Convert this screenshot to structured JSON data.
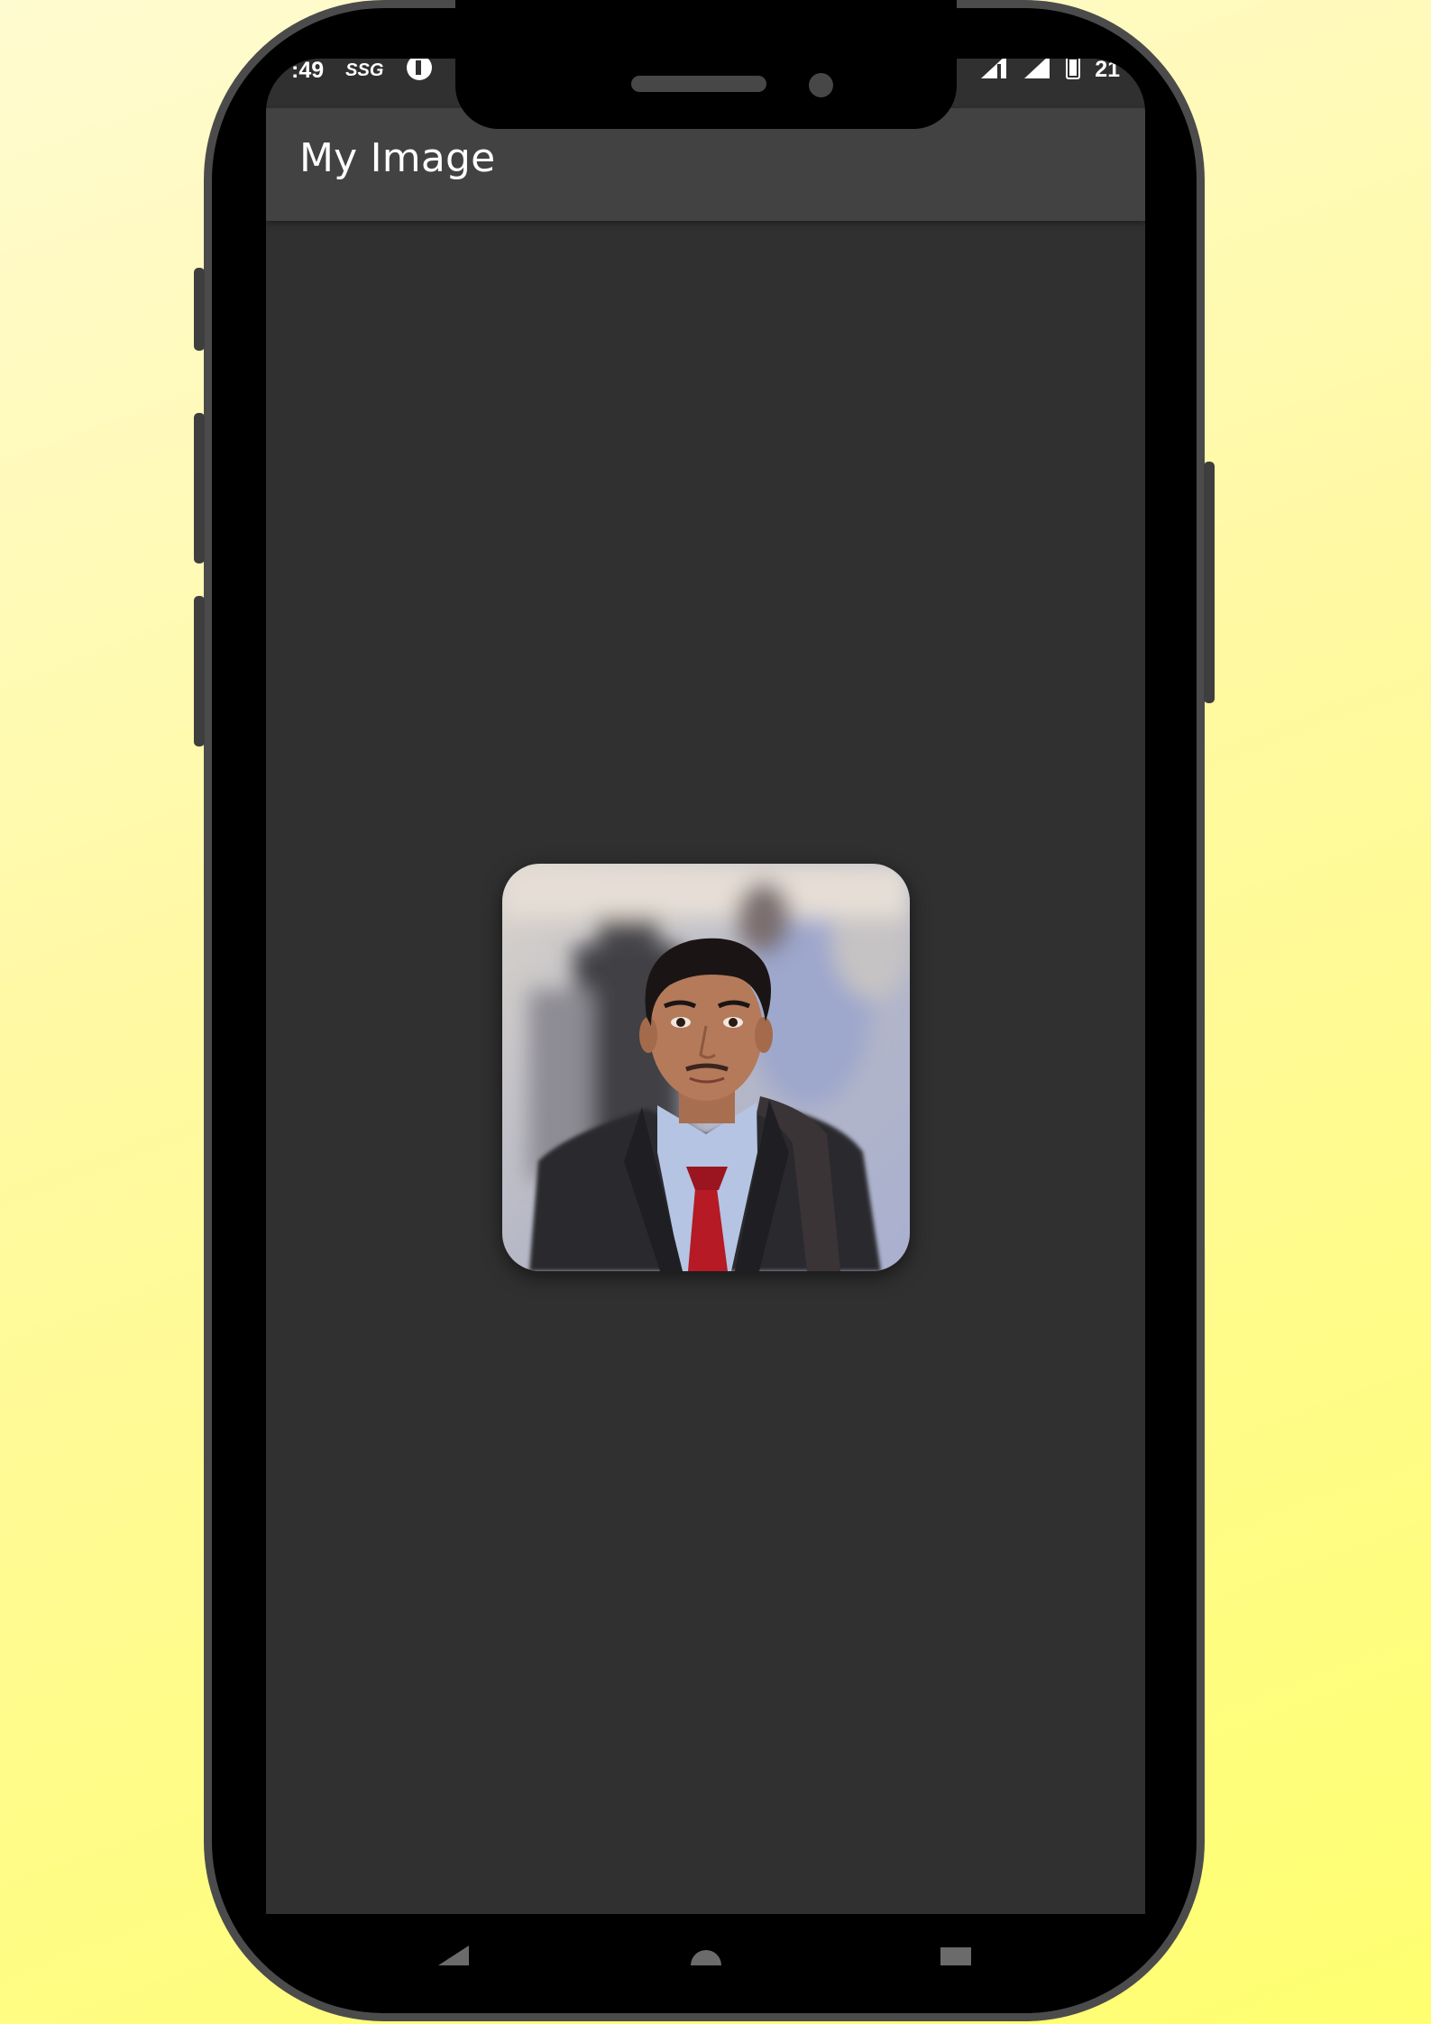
{
  "status_bar": {
    "time": ":49",
    "carrier_tag": "SSG",
    "battery": "21"
  },
  "app_bar": {
    "title": "My Image"
  },
  "content": {
    "image": {
      "subject": "portrait photo of a young man in a dark suit with a red tie"
    }
  },
  "nav_bar": {
    "buttons": [
      "back",
      "home",
      "recents"
    ]
  },
  "colors": {
    "background_yellow": "#ffff70",
    "phone_frame": "#4b4b4b",
    "screen_bg": "#303030",
    "app_bar_bg": "#424242",
    "tie_red": "#b51a25"
  }
}
